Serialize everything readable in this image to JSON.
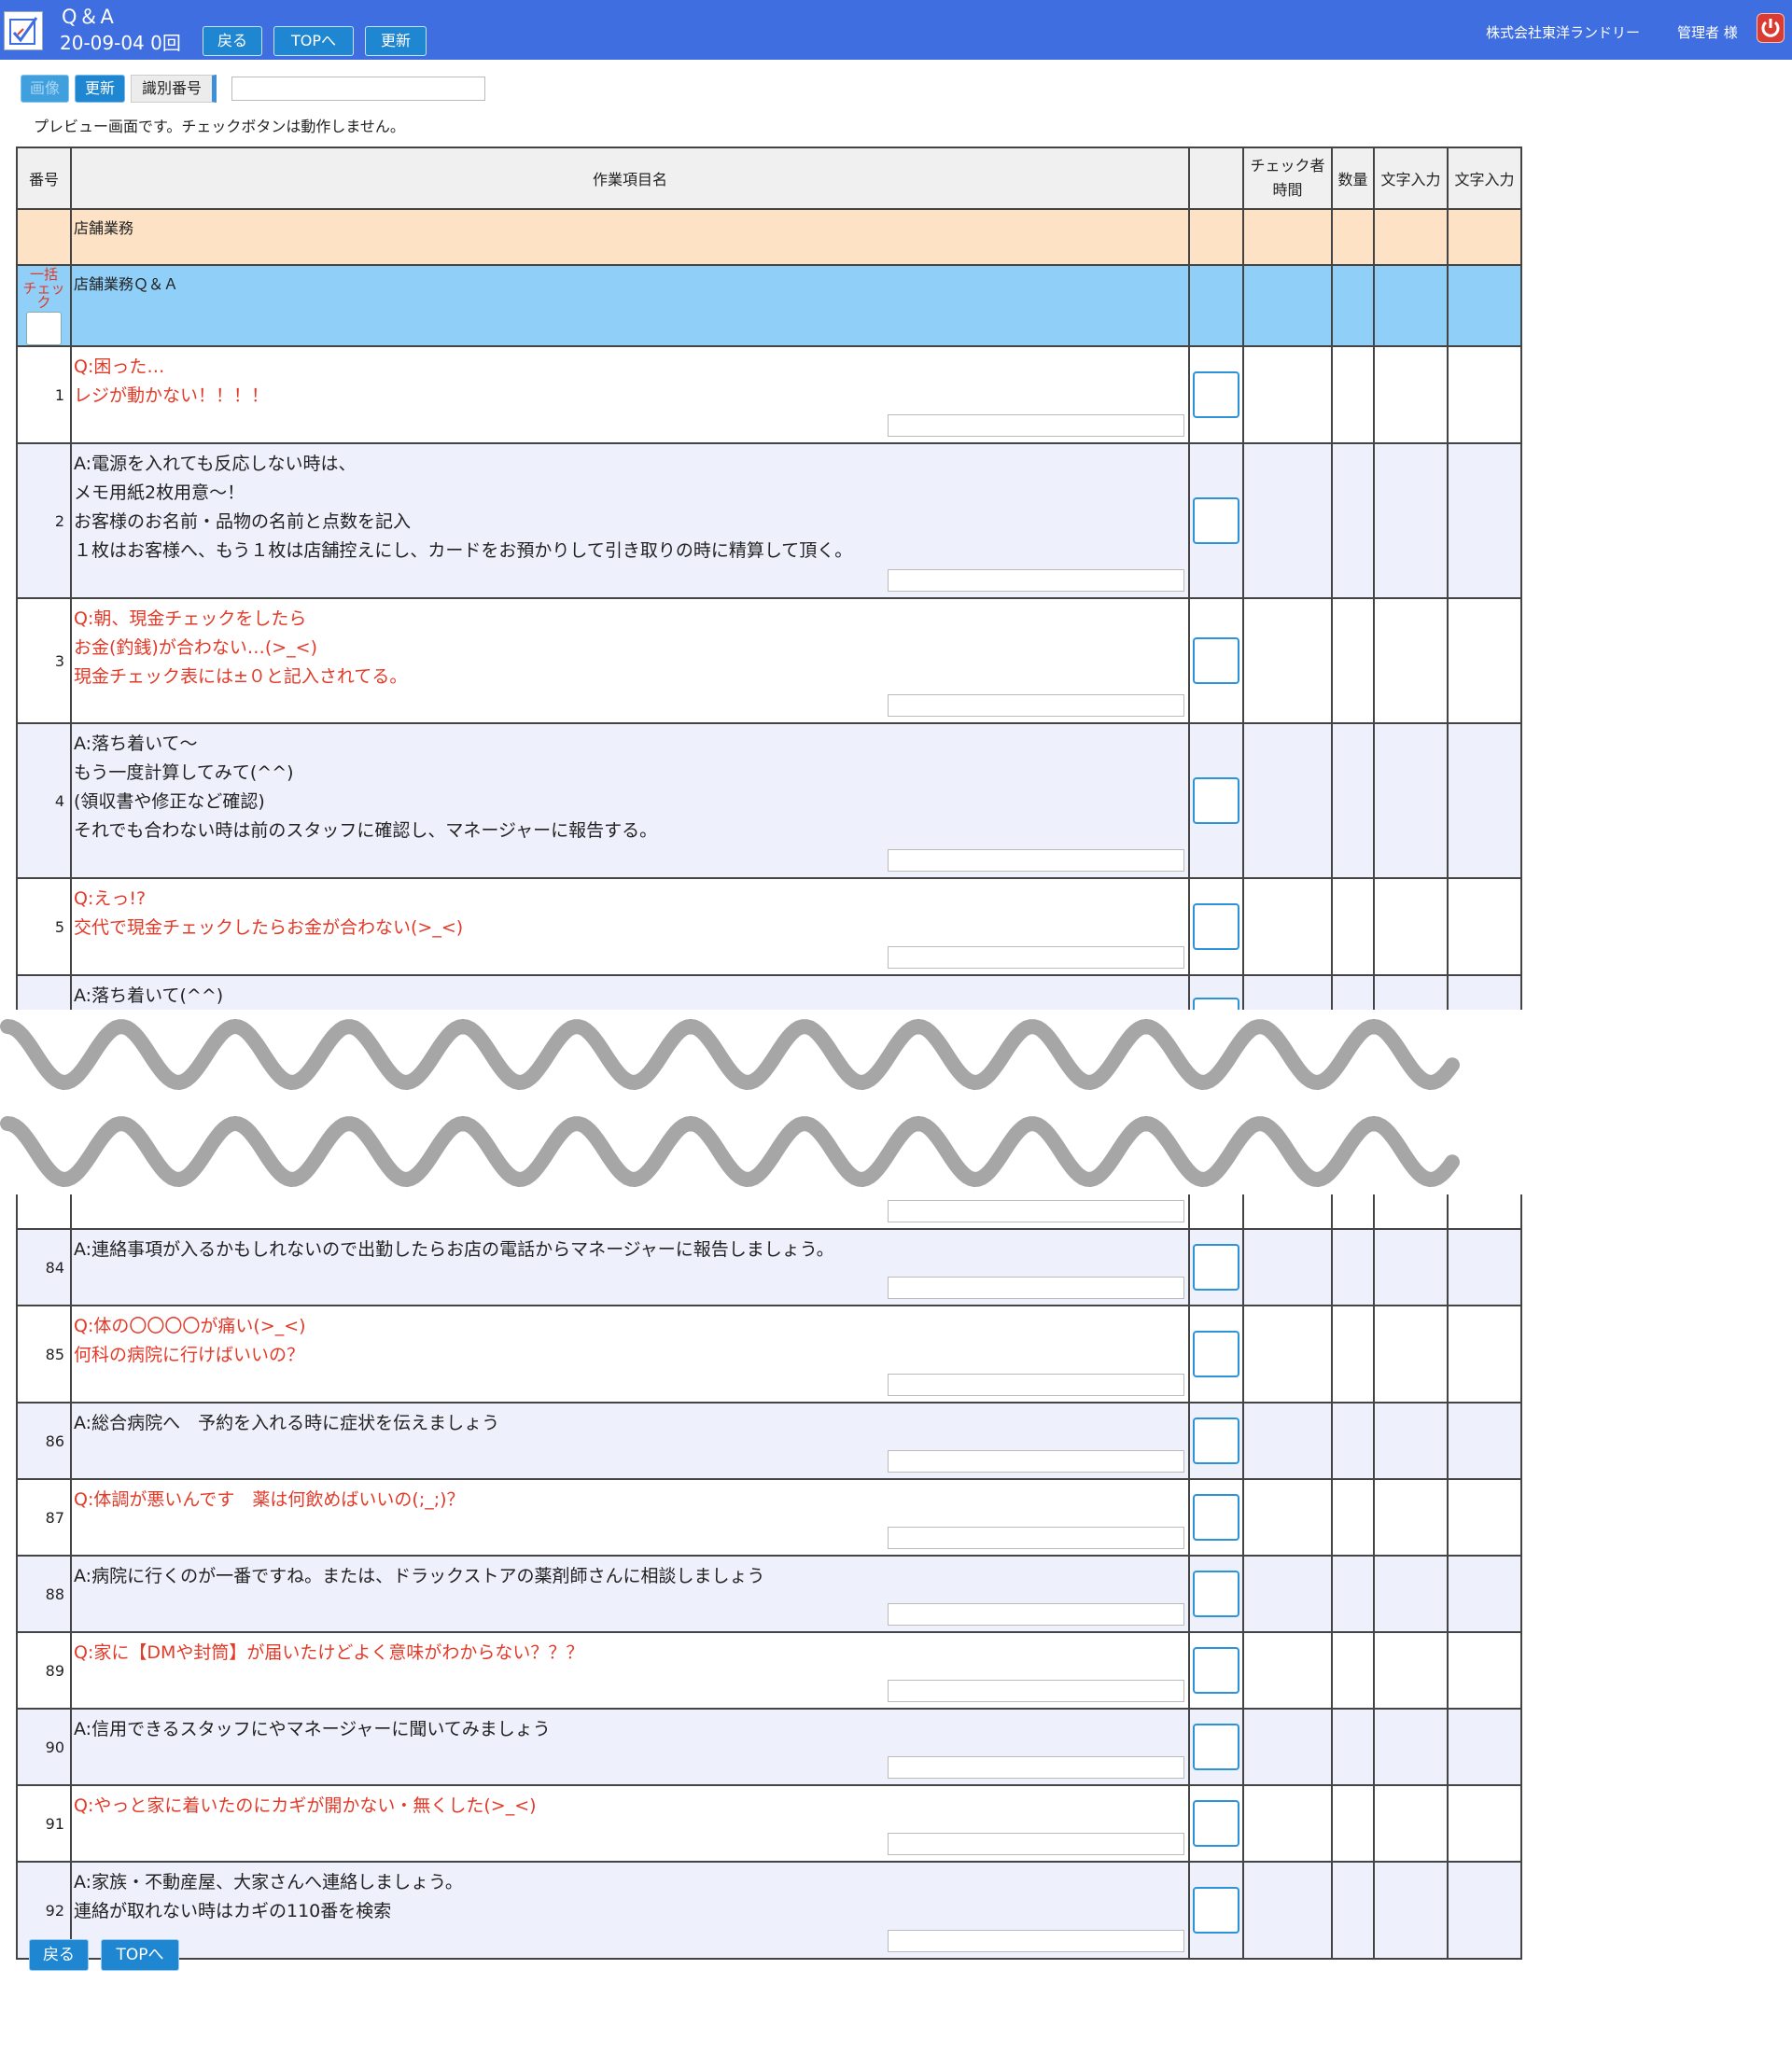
{
  "header": {
    "title": "Q＆A",
    "date_count": "20-09-04 0回",
    "back_label": "戻る",
    "top_label": "TOPへ",
    "refresh_label": "更新",
    "company": "株式会社東洋ランドリー",
    "user": "管理者 様",
    "icons": {
      "logo": "checklist-logo-icon",
      "power": "power-icon"
    },
    "colors": {
      "bar": "#3f6ee0",
      "button": "#1f86d2",
      "power": "#d83c32"
    }
  },
  "toolbar": {
    "dim_label": "画像",
    "update_label": "更新",
    "id_label": "識別番号",
    "id_value": ""
  },
  "preview_note": "プレビュー画面です。チェックボタンは動作しません。",
  "table": {
    "headers": {
      "number": "番号",
      "item": "作業項目名",
      "check": "",
      "checker_line1": "チェック者",
      "checker_line2": "時間",
      "quantity": "数量",
      "text1": "文字入力",
      "text2": "文字入力"
    },
    "category": "店舗業務",
    "subcategory": "店舗業務Ｑ＆Ａ",
    "bulk_check_label": "一括\nチェック",
    "colors": {
      "category": "#fde2c6",
      "subcategory": "#8fcff8",
      "question": "#e23a28",
      "even_row": "#eef0fc"
    },
    "rows_top": [
      {
        "no": "1",
        "kind": "q",
        "text": "Q:困った…\nレジが動かない！！！！"
      },
      {
        "no": "2",
        "kind": "a",
        "text": "A:電源を入れても反応しない時は、\nメモ用紙2枚用意〜！\nお客様のお名前・品物の名前と点数を記入\n１枚はお客様へ、もう１枚は店舗控えにし、カードをお預かりして引き取りの時に精算して頂く。"
      },
      {
        "no": "3",
        "kind": "q",
        "text": "Q:朝、現金チェックをしたら\nお金(釣銭)が合わない…(>_<)\n現金チェック表には±０と記入されてる。"
      },
      {
        "no": "4",
        "kind": "a",
        "text": "A:落ち着いて〜\nもう一度計算してみて(^^)\n(領収書や修正など確認)\nそれでも合わない時は前のスタッフに確認し、マネージャーに報告する。"
      },
      {
        "no": "5",
        "kind": "q",
        "text": "Q:えっ!?\n交代で現金チェックしたらお金が合わない(>_<)"
      },
      {
        "no": "",
        "kind": "a",
        "text": "A:落ち着いて(^^)\nもう一度確認してみよう！"
      }
    ],
    "rows_bottom": [
      {
        "no": "84",
        "kind": "a",
        "text": "A:連絡事項が入るかもしれないので出勤したらお店の電話からマネージャーに報告しましょう。"
      },
      {
        "no": "85",
        "kind": "q",
        "text": "Q:体の〇〇〇〇が痛い(>_<)\n何科の病院に行けばいいの？"
      },
      {
        "no": "86",
        "kind": "a",
        "text": "A:総合病院へ　予約を入れる時に症状を伝えましょう"
      },
      {
        "no": "87",
        "kind": "q",
        "text": "Q:体調が悪いんです　薬は何飲めばいいの(;_;)？"
      },
      {
        "no": "88",
        "kind": "a",
        "text": "A:病院に行くのが一番ですね。または、ドラックストアの薬剤師さんに相談しましょう"
      },
      {
        "no": "89",
        "kind": "q",
        "text": "Q:家に【DMや封筒】が届いたけどよく意味がわからない？？？"
      },
      {
        "no": "90",
        "kind": "a",
        "text": "A:信用できるスタッフにやマネージャーに聞いてみましょう"
      },
      {
        "no": "91",
        "kind": "q",
        "text": "Q:やっと家に着いたのにカギが開かない・無くした(>_<)"
      },
      {
        "no": "92",
        "kind": "a",
        "text": "A:家族・不動産屋、大家さんへ連絡しましょう。\n連絡が取れない時はカギの110番を検索"
      }
    ]
  },
  "footer": {
    "back_label": "戻る",
    "top_label": "TOPへ"
  }
}
